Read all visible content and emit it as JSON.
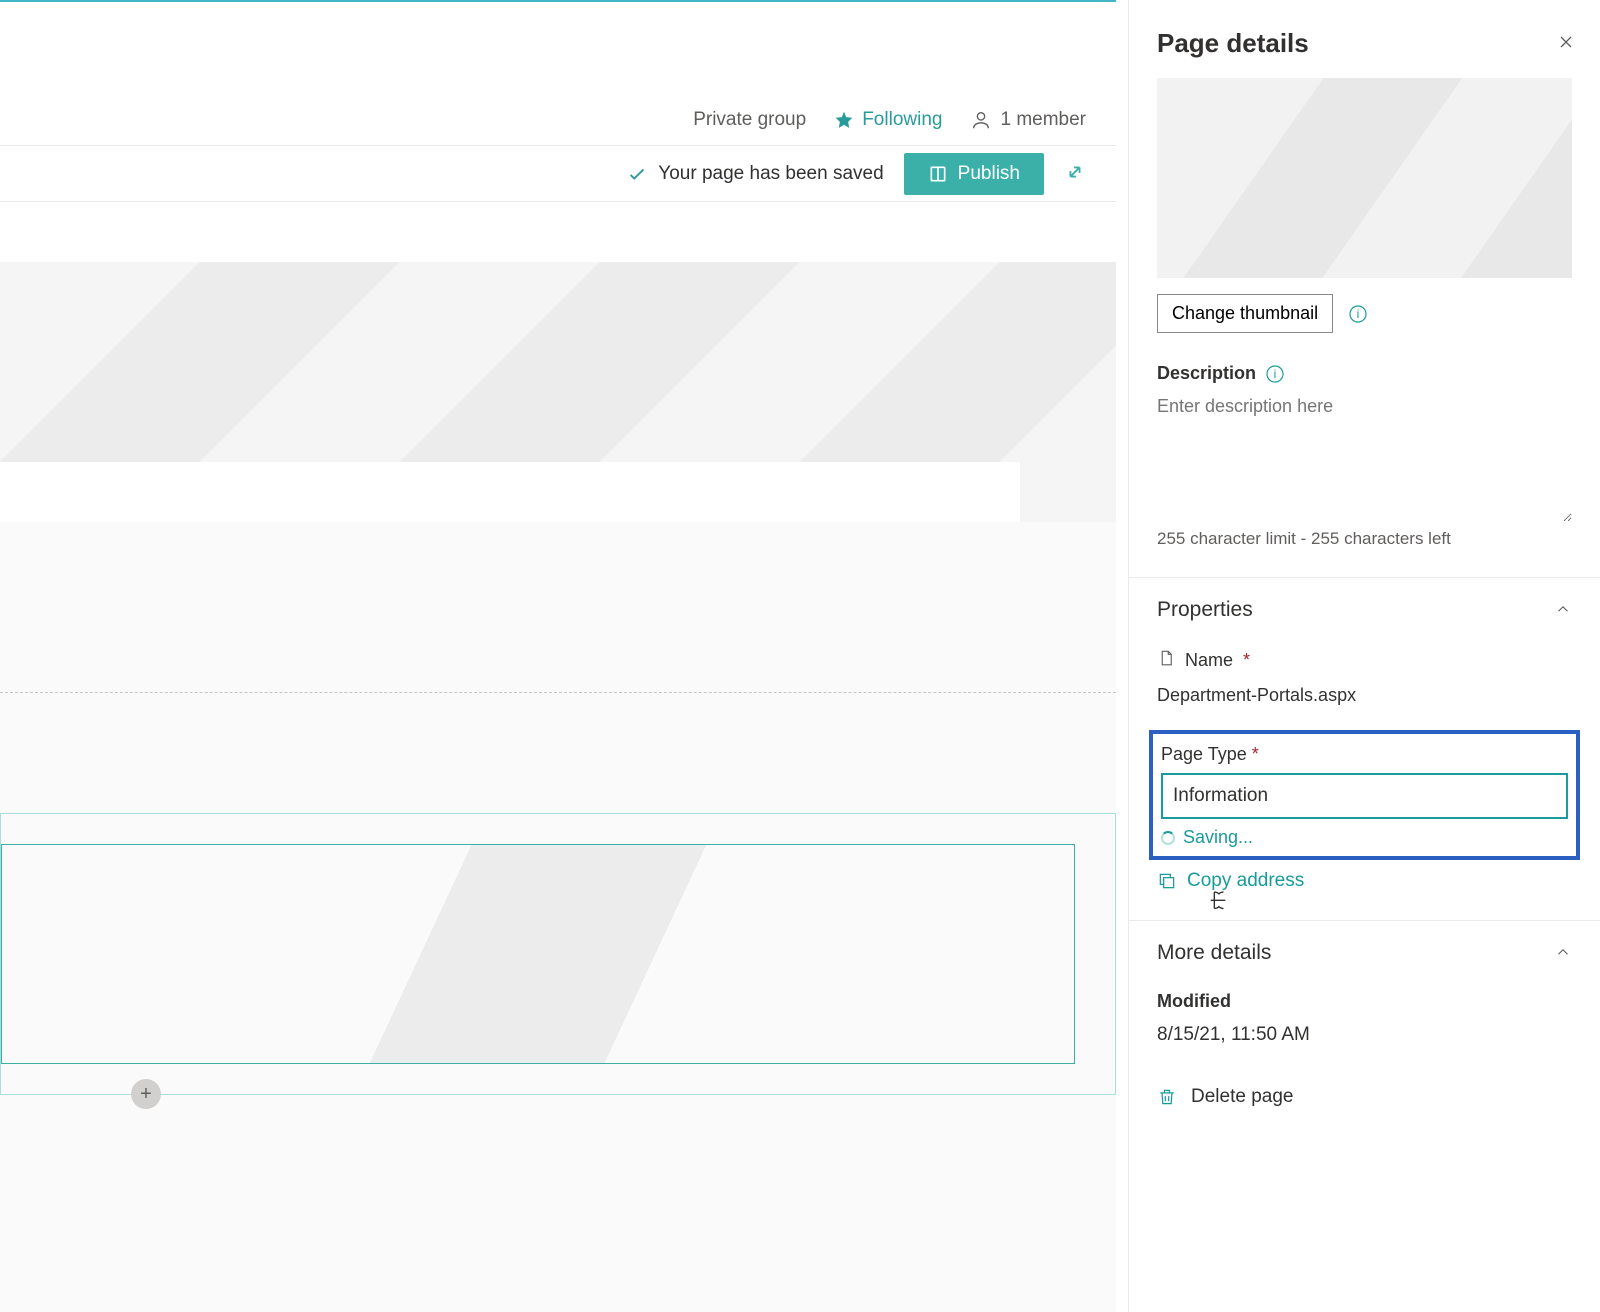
{
  "header": {
    "group_privacy": "Private group",
    "follow_label": "Following",
    "member_count": "1 member"
  },
  "commandbar": {
    "saved_message": "Your page has been saved",
    "publish_label": "Publish"
  },
  "panel": {
    "title": "Page details",
    "change_thumbnail_label": "Change thumbnail",
    "description": {
      "label": "Description",
      "placeholder": "Enter description here",
      "char_limit_text": "255 character limit - 255 characters left"
    },
    "properties": {
      "section_title": "Properties",
      "name_label": "Name",
      "name_value": "Department-Portals.aspx",
      "page_type_label": "Page Type",
      "page_type_value": "Information",
      "saving_text": "Saving...",
      "copy_address_label": "Copy address"
    },
    "more_details": {
      "section_title": "More details",
      "modified_label": "Modified",
      "modified_value": "8/15/21, 11:50 AM"
    },
    "delete_label": "Delete page"
  }
}
